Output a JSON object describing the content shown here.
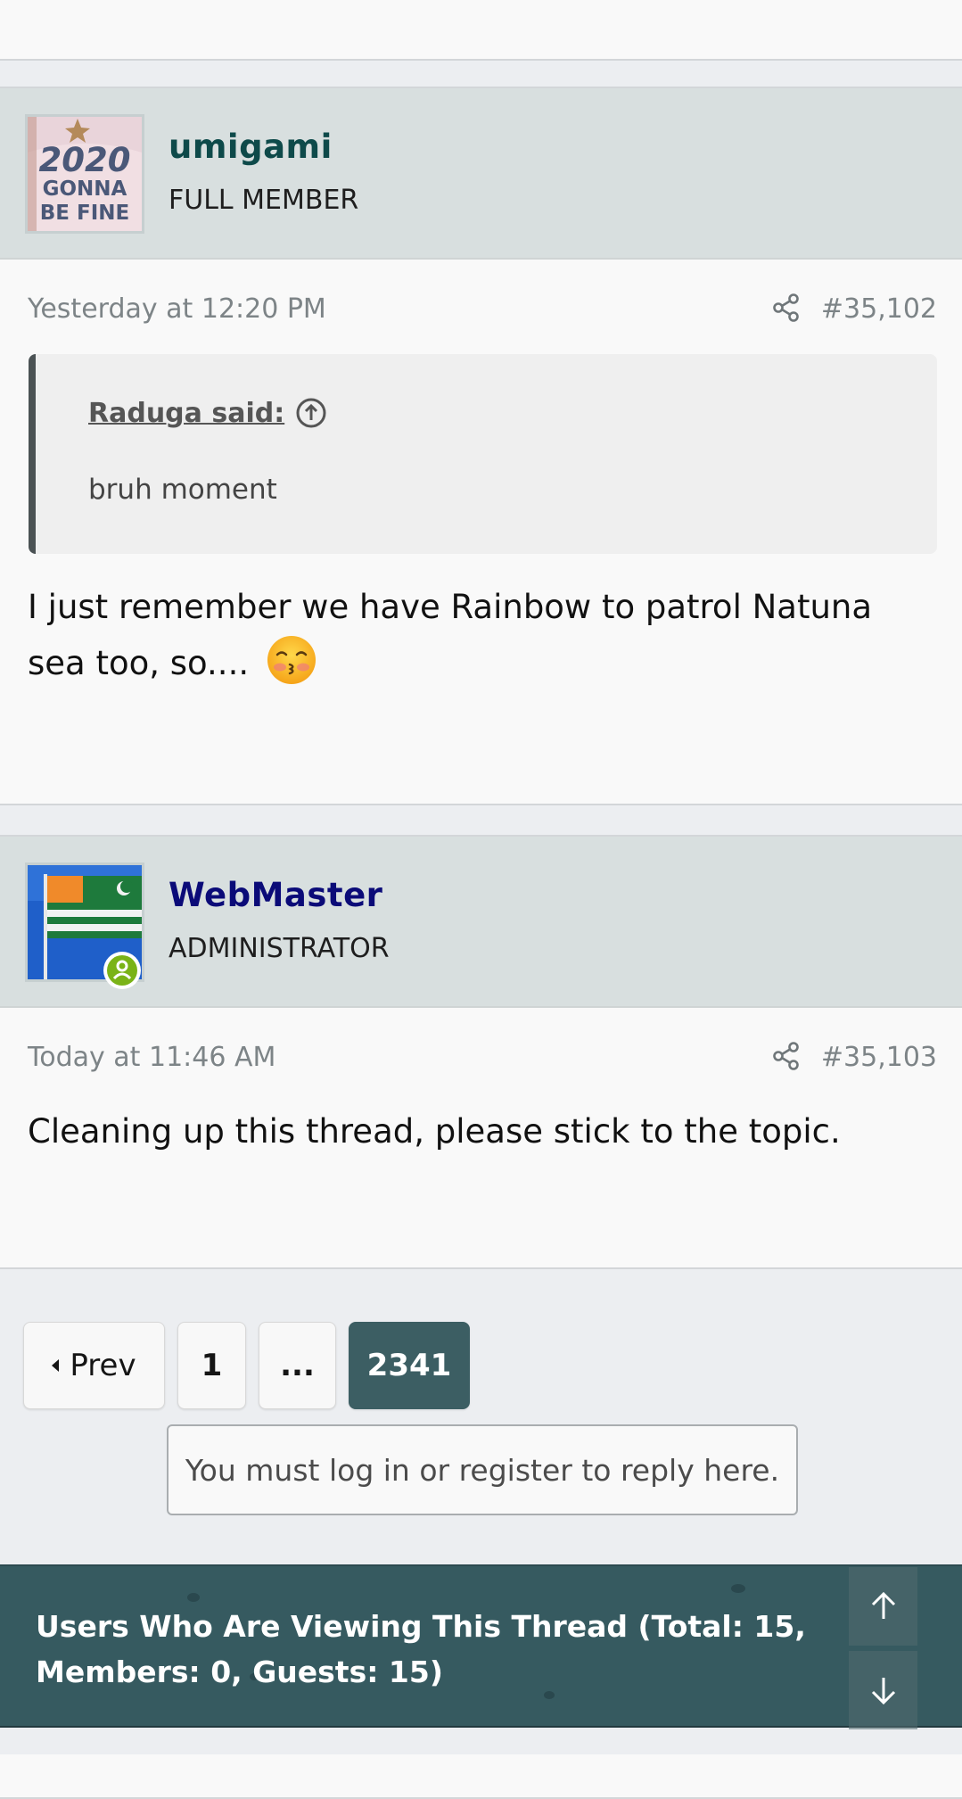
{
  "posts": [
    {
      "username": "umigami",
      "username_color": "#0e4a4a",
      "user_title": "FULL MEMBER",
      "avatar_text": [
        "2020",
        "GONNA",
        "BE FINE"
      ],
      "date": "Yesterday at 12:20 PM",
      "post_number": "#35,102",
      "quote": {
        "author": "Raduga said:",
        "text": "bruh moment"
      },
      "message": "I just remember we have Rainbow to patrol Natuna sea too, so.... "
    },
    {
      "username": "WebMaster",
      "username_color": "#0b0b78",
      "user_title": "ADMINISTRATOR",
      "date": "Today at 11:46 AM",
      "post_number": "#35,103",
      "message": "Cleaning up this thread, please stick to the topic."
    }
  ],
  "pagination": {
    "prev": "Prev",
    "first": "1",
    "ellipsis": "...",
    "current": "2341"
  },
  "reply_notice": "You must log in or register to reply here.",
  "viewers": {
    "text": "Users Who Are Viewing This Thread (Total: 15, Members: 0, Guests: 15)"
  },
  "colors": {
    "accent": "#3c5e63",
    "user_header_bg": "#d8dfdf",
    "online_badge": "#7ab317"
  },
  "icons": [
    "share-icon",
    "arrow-up-circle-icon",
    "kissing-face-emoji",
    "online-status-icon",
    "arrow-up-icon",
    "arrow-down-icon"
  ]
}
